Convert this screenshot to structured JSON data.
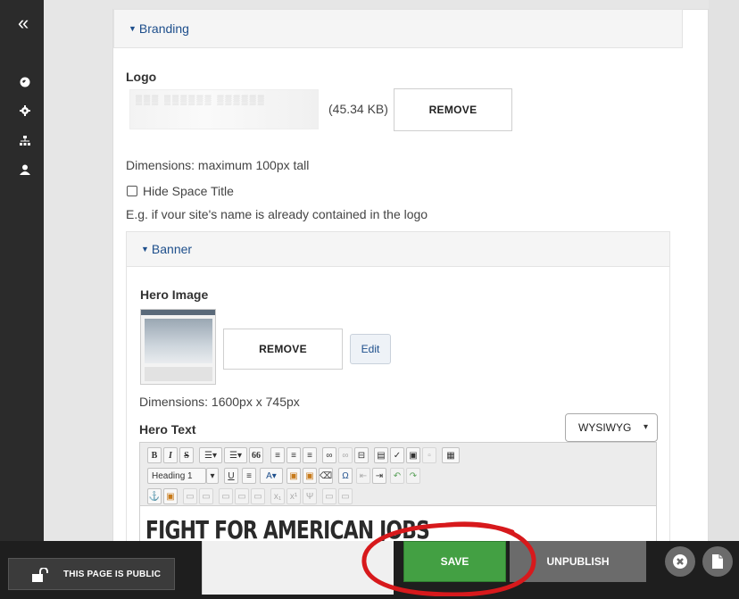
{
  "sidebar": {
    "collapse_glyph": "«",
    "icons": [
      "globe-icon",
      "gear-icon",
      "sitemap-icon",
      "user-icon"
    ]
  },
  "branding": {
    "header": "Branding",
    "logo_label": "Logo",
    "logo_size": "(45.34 KB)",
    "remove_label": "REMOVE",
    "dimensions_note": "Dimensions: maximum 100px tall",
    "hide_title_label": "Hide Space Title",
    "hide_title_checked": false,
    "hide_title_help": "E.g. if vour site's name is already contained in the logo"
  },
  "banner": {
    "header": "Banner",
    "hero_image_label": "Hero Image",
    "remove_label": "REMOVE",
    "edit_label": "Edit",
    "dimensions": "Dimensions: 1600px x 745px",
    "hero_text_label": "Hero Text",
    "editor_mode": "WYSIWYG",
    "format_select": "Heading 1",
    "hero_heading": "FIGHT FOR AMERICAN JOBS"
  },
  "toolbar_buttons": {
    "bold": "B",
    "italic": "I",
    "strike": "S",
    "underline": "U",
    "quote": "66",
    "special_char": "Ω"
  },
  "footer": {
    "public_label": "THIS PAGE IS PUBLIC",
    "save_label": "SAVE",
    "unpublish_label": "UNPUBLISH"
  },
  "colors": {
    "save_green": "#43a043",
    "unpublish_gray": "#6b6b6b",
    "link_blue": "#1e4f8c",
    "annotation_red": "#d7191c"
  }
}
